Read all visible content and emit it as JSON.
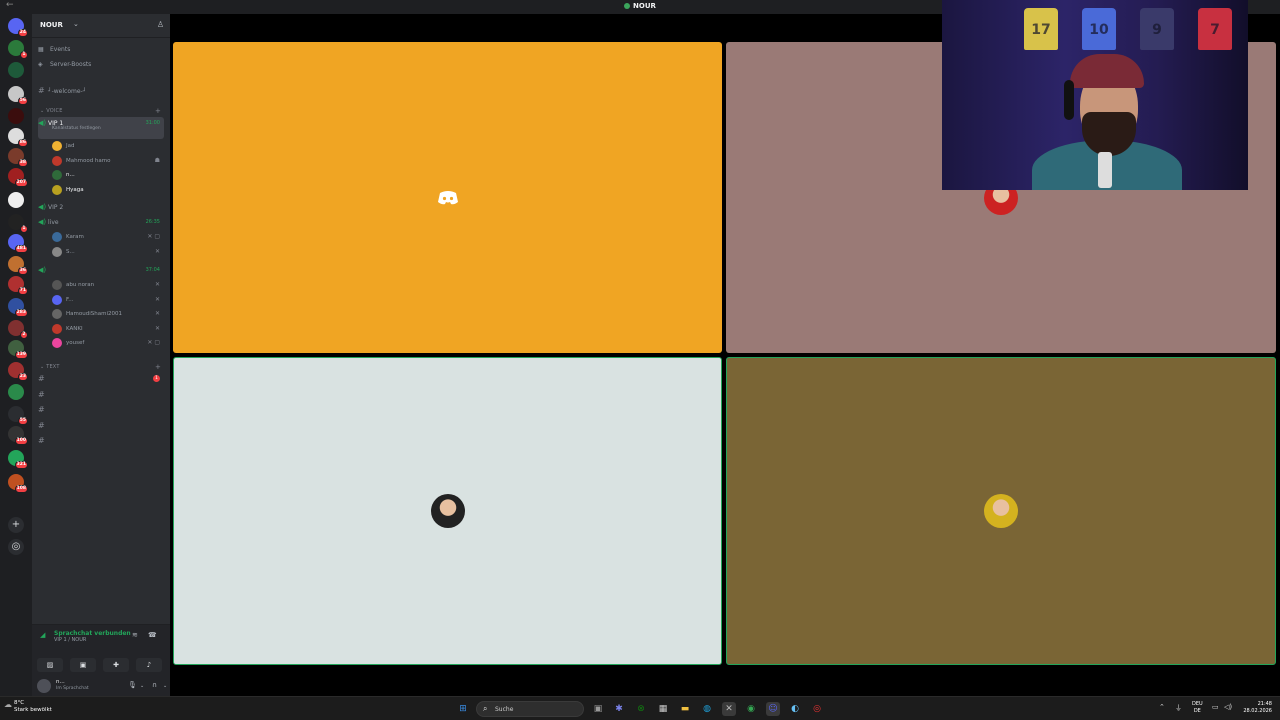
{
  "window": {
    "title": "NOUR",
    "back_glyph": "←"
  },
  "rail": {
    "servers": [
      {
        "name": "discord-home",
        "badge": "24",
        "color": "#5865f2"
      },
      {
        "name": "server-1",
        "badge": "1",
        "color": "#2b7a3b"
      },
      {
        "name": "server-2",
        "badge": "",
        "color": "#1e5a3a"
      },
      {
        "name": "server-3",
        "badge": "56",
        "color": "#c7c7c7"
      },
      {
        "name": "server-4",
        "badge": "",
        "color": "#3b0d0d"
      },
      {
        "name": "server-5",
        "badge": "86",
        "color": "#dddddd"
      },
      {
        "name": "server-6",
        "badge": "38",
        "color": "#7a3b2b"
      },
      {
        "name": "server-7",
        "badge": "207",
        "color": "#a02020"
      },
      {
        "name": "server-8",
        "badge": "",
        "color": "#eeeeee"
      },
      {
        "name": "server-9",
        "badge": "1",
        "color": "#222222"
      },
      {
        "name": "server-10",
        "badge": "481",
        "color": "#5865f2"
      },
      {
        "name": "server-11",
        "badge": "36",
        "color": "#c07030"
      },
      {
        "name": "server-12",
        "badge": "71",
        "color": "#b03030"
      },
      {
        "name": "server-13",
        "badge": "283",
        "color": "#3050a0"
      },
      {
        "name": "server-14",
        "badge": "2",
        "color": "#803030"
      },
      {
        "name": "server-15",
        "badge": "139",
        "color": "#406040"
      },
      {
        "name": "server-16",
        "badge": "23",
        "color": "#a03030"
      },
      {
        "name": "server-17",
        "badge": "",
        "color": "#2a8a4a"
      },
      {
        "name": "server-18",
        "badge": "55",
        "color": "#2b2d31"
      },
      {
        "name": "server-19",
        "badge": "100",
        "color": "#333333"
      },
      {
        "name": "server-20",
        "badge": "321",
        "color": "#23a55a"
      },
      {
        "name": "server-21",
        "badge": "108",
        "color": "#c05020"
      }
    ],
    "add_glyph": "+",
    "explore_glyph": "◎"
  },
  "sidebar": {
    "server_name": "NOUR",
    "menu": [
      {
        "label": "Events",
        "icon": "calendar-icon",
        "glyph": "▦"
      },
      {
        "label": "Server-Boosts",
        "icon": "boost-icon",
        "glyph": "◈"
      }
    ],
    "welcome_channel": "┘-welcome-┘",
    "voice_category": "VOICE",
    "text_category": "TEXT",
    "vip1": {
      "name": "VIP 1",
      "time": "31:00",
      "status": "Kanalstatus festlegen",
      "members": [
        {
          "name": "Jad",
          "color": "#f0b232",
          "bright": false,
          "status": ""
        },
        {
          "name": "Mahmood hamo",
          "color": "#c0392b",
          "bright": false,
          "status": "☗"
        },
        {
          "name": "n...",
          "color": "#2f6a3a",
          "bright": true,
          "status": ""
        },
        {
          "name": "Hyaga",
          "color": "#b8a020",
          "bright": true,
          "status": ""
        }
      ]
    },
    "vip2": {
      "name": "VIP 2"
    },
    "live": {
      "name": "live",
      "time": "26:35",
      "members": [
        {
          "name": "Karam",
          "color": "#3a6a9a",
          "status": "✕ ▢"
        },
        {
          "name": "S...",
          "color": "#888888",
          "status": "✕"
        }
      ]
    },
    "third": {
      "name": "",
      "time": "37:04",
      "members": [
        {
          "name": "abu noran",
          "color": "#555555",
          "status": "✕"
        },
        {
          "name": "F...",
          "color": "#5865f2",
          "status": "✕"
        },
        {
          "name": "HamoudiShami2001",
          "color": "#666666",
          "status": "✕"
        },
        {
          "name": "KANKI",
          "color": "#c0392b",
          "status": "✕"
        },
        {
          "name": "yousef",
          "color": "#eb459e",
          "status": "✕ ▢"
        }
      ]
    },
    "text_channels": [
      {
        "name": "",
        "unread": "1",
        "bright": true
      },
      {
        "name": "",
        "unread": "",
        "bright": false
      },
      {
        "name": "",
        "unread": "",
        "bright": false
      },
      {
        "name": "",
        "unread": "",
        "bright": false
      },
      {
        "name": "",
        "unread": "",
        "bright": false
      }
    ],
    "voice_panel": {
      "connected": "Sprachchat verbunden",
      "location": "VIP 1 / NOUR"
    },
    "user_panel": {
      "name": "n...",
      "status": "Im Sprachchat"
    }
  },
  "stage": {
    "tiles": [
      {
        "name": "tile-1",
        "bg": "#f0a523",
        "kind": "discord-logo",
        "border": "none"
      },
      {
        "name": "tile-2",
        "bg": "#9a7a76",
        "kind": "avatar",
        "avatar_color": "#c22",
        "border": "none"
      },
      {
        "name": "tile-3",
        "bg": "#d9e2e1",
        "kind": "avatar",
        "avatar_color": "#222",
        "border": "#23a55a"
      },
      {
        "name": "tile-4",
        "bg": "#7a6535",
        "kind": "avatar",
        "avatar_color": "#d4b21f",
        "border": "#23a55a"
      }
    ]
  },
  "webcam": {
    "jerseys": [
      {
        "label": "",
        "num": "17",
        "color": "#d8c24a"
      },
      {
        "label": "",
        "num": "10",
        "color": "#4a6ad8"
      },
      {
        "label": "",
        "num": "9",
        "color": "#3a3a6a"
      },
      {
        "label": "",
        "num": "7",
        "color": "#c83040"
      }
    ]
  },
  "taskbar": {
    "weather_temp": "8°C",
    "weather_desc": "Stark bewölkt",
    "search_placeholder": "Suche",
    "lang_1": "DEU",
    "lang_2": "DE",
    "time": "21:48",
    "date": "28.02.2026",
    "apps": [
      {
        "name": "start-icon",
        "glyph": "⊞",
        "color": "#3a8ee6"
      },
      {
        "name": "taskview-icon",
        "glyph": "▣",
        "color": "#999"
      },
      {
        "name": "teams-icon",
        "glyph": "✱",
        "color": "#7b83eb"
      },
      {
        "name": "xbox-icon",
        "glyph": "⊗",
        "color": "#107c10"
      },
      {
        "name": "calendar-app-icon",
        "glyph": "▦",
        "color": "#ccc"
      },
      {
        "name": "explorer-icon",
        "glyph": "▬",
        "color": "#f0c040"
      },
      {
        "name": "edge-icon",
        "glyph": "◍",
        "color": "#1fa0d8"
      },
      {
        "name": "app-x-icon",
        "glyph": "✕",
        "color": "#bbb"
      },
      {
        "name": "chrome-icon",
        "glyph": "◉",
        "color": "#34a853"
      },
      {
        "name": "discord-taskbar-icon",
        "glyph": "☺",
        "color": "#5865f2"
      },
      {
        "name": "steam-icon",
        "glyph": "◐",
        "color": "#66c0f4"
      },
      {
        "name": "record-icon",
        "glyph": "◎",
        "color": "#e33"
      }
    ]
  }
}
